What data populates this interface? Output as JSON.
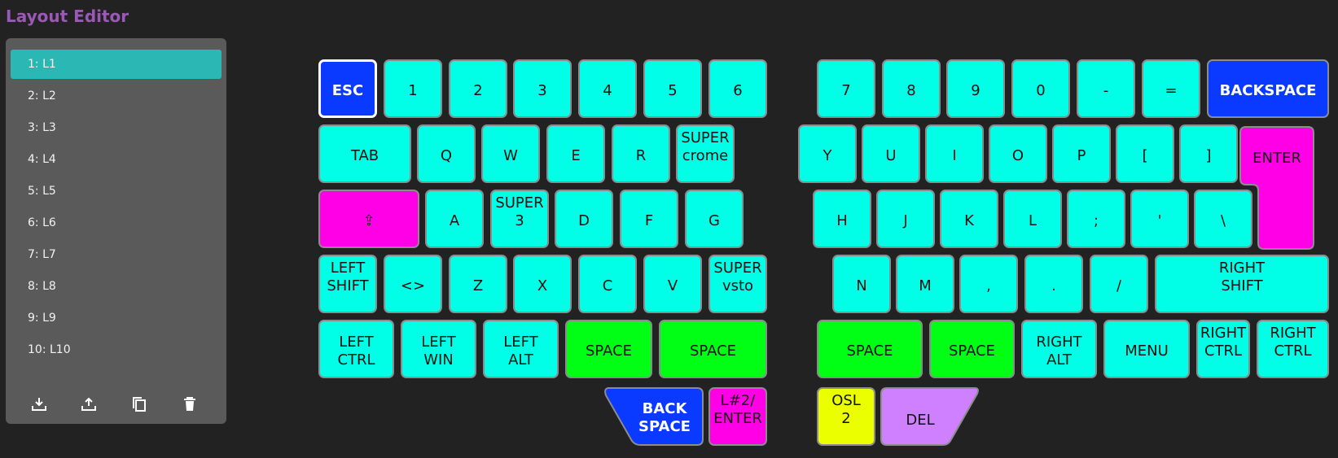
{
  "app": {
    "title": "Layout Editor"
  },
  "layers": [
    {
      "label": "1: L1"
    },
    {
      "label": "2: L2"
    },
    {
      "label": "3: L3"
    },
    {
      "label": "4: L4"
    },
    {
      "label": "5: L5"
    },
    {
      "label": "6: L6"
    },
    {
      "label": "7: L7"
    },
    {
      "label": "8: L8"
    },
    {
      "label": "9: L9"
    },
    {
      "label": "10: L10"
    }
  ],
  "active_layer": "1: L1",
  "toolbar": {
    "icons": [
      "download-icon",
      "upload-icon",
      "copy-icon",
      "delete-icon"
    ]
  },
  "colors": {
    "accent": "#9b59b6",
    "layer_selected": "#2bb7b3",
    "key_default": "#00ffe6",
    "key_blue": "#0a39ff",
    "key_magenta": "#ff00e6",
    "key_green": "#00ff15",
    "key_yellow": "#ecff00",
    "key_violet": "#cf80ff"
  },
  "keys": {
    "r1": [
      "ESC",
      "1",
      "2",
      "3",
      "4",
      "5",
      "6",
      "7",
      "8",
      "9",
      "0",
      "-",
      "=",
      "BACKSPACE"
    ],
    "r2": [
      "TAB",
      "Q",
      "W",
      "E",
      "R",
      "SUPER\ncrome",
      "Y",
      "U",
      "I",
      "O",
      "P",
      "[",
      "]",
      "ENTER"
    ],
    "r3": [
      "⇪",
      "A",
      "SUPER\n3",
      "D",
      "F",
      "G",
      "H",
      "J",
      "K",
      "L",
      ";",
      "'",
      "\\"
    ],
    "r4": [
      "LEFT\nSHIFT",
      "<>",
      "Z",
      "X",
      "C",
      "V",
      "SUPER\nvsto",
      "N",
      "M",
      ",",
      ".",
      "/",
      "RIGHT\nSHIFT"
    ],
    "r5": [
      "LEFT\nCTRL",
      "LEFT\nWIN",
      "LEFT\nALT",
      "SPACE",
      "SPACE",
      "SPACE",
      "SPACE",
      "RIGHT\nALT",
      "MENU",
      "RIGHT\nCTRL",
      "RIGHT\nCTRL"
    ],
    "thumb": [
      "BACK\nSPACE",
      "L#2/\nENTER",
      "OSL\n2",
      "DEL"
    ]
  }
}
